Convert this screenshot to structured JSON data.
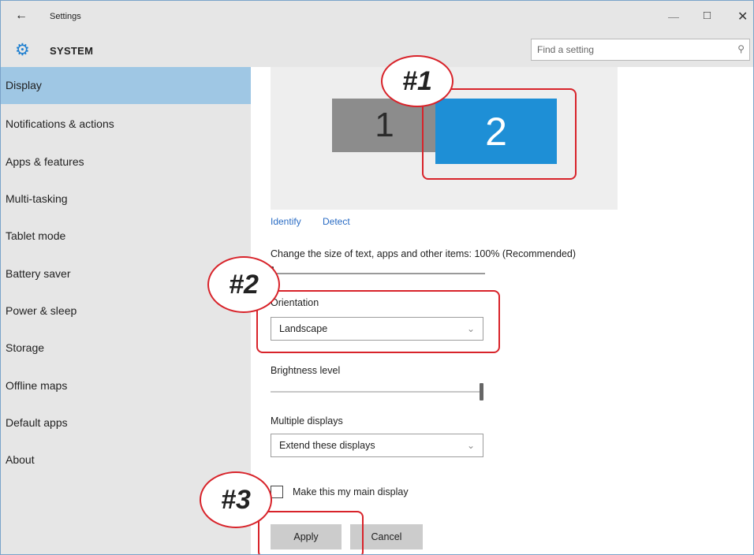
{
  "titlebar": {
    "back_icon": "back-arrow-icon",
    "title": "Settings",
    "minimize_glyph": "—",
    "maximize_glyph": "□",
    "close_glyph": "✕"
  },
  "header": {
    "icon": "gear-icon",
    "section": "SYSTEM",
    "search_placeholder": "Find a setting",
    "search_icon": "search-icon"
  },
  "sidebar": {
    "items": [
      {
        "label": "Display",
        "active": true
      },
      {
        "label": "Notifications & actions"
      },
      {
        "label": "Apps & features"
      },
      {
        "label": "Multi-tasking"
      },
      {
        "label": "Tablet mode"
      },
      {
        "label": "Battery saver"
      },
      {
        "label": "Power & sleep"
      },
      {
        "label": "Storage"
      },
      {
        "label": "Offline maps"
      },
      {
        "label": "Default apps"
      },
      {
        "label": "About"
      }
    ]
  },
  "display": {
    "monitors": [
      {
        "label": "1",
        "selected": false
      },
      {
        "label": "2",
        "selected": true
      }
    ],
    "identify_link": "Identify",
    "detect_link": "Detect",
    "scale_label": "Change the size of text, apps and other items: 100% (Recommended)",
    "scale_level": 0.0,
    "orientation_label": "Orientation",
    "orientation_value": "Landscape",
    "brightness_label": "Brightness level",
    "brightness_level": 1.0,
    "multiple_displays_label": "Multiple displays",
    "multiple_displays_value": "Extend these displays",
    "main_display_checkbox_label": "Make this my main display",
    "main_display_checked": false,
    "apply_button": "Apply",
    "cancel_button": "Cancel"
  },
  "annotations": [
    {
      "label": "#1"
    },
    {
      "label": "#2"
    },
    {
      "label": "#3"
    }
  ],
  "colors": {
    "accent": "#1e8fd6",
    "sidebar_active": "#9fc7e4",
    "annotation": "#d8232a",
    "link": "#2a6cc4"
  }
}
